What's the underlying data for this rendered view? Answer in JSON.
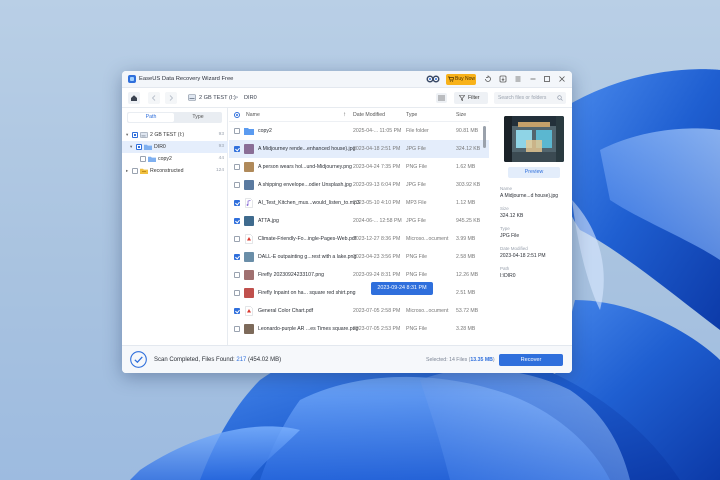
{
  "window": {
    "title": "EaseUS Data Recovery Wizard Free",
    "buy_label": "Buy Now"
  },
  "navbar": {
    "breadcrumb": [
      "2 GB TEST (I:)",
      "DIR0"
    ],
    "breadcrumb_sep": ">",
    "filter_label": "Filter",
    "search_placeholder": "Search files or folders"
  },
  "tree": {
    "tabs": [
      "Path",
      "Type"
    ],
    "active_tab": "Path",
    "items": [
      {
        "label": "2 GB TEST (I:)",
        "count": "93",
        "expanded": true,
        "checked": "partial"
      },
      {
        "label": "DIR0",
        "count": "93",
        "expanded": true,
        "checked": "partial",
        "selected": true
      },
      {
        "label": "copy2",
        "count": "44"
      },
      {
        "label": "Reconstructed",
        "count": "124",
        "expanded": false,
        "checked": false
      }
    ]
  },
  "list": {
    "columns": [
      "Name",
      "Date Modified",
      "Type",
      "Size"
    ],
    "sort_indicator": "↑",
    "rows": [
      {
        "name": "copy2",
        "date": "2025-04-... 11:05 PM",
        "type": "File folder",
        "size": "90.81 MB",
        "checked": false,
        "icon": "folder-icon"
      },
      {
        "name": "A Midjourney rende...enhanced house).jpg",
        "date": "2023-04-18 2:51 PM",
        "type": "JPG File",
        "size": "324.12 KB",
        "checked": true,
        "selected": true,
        "icon": "image-thumbnail"
      },
      {
        "name": "A person wears hol...und-Midjourney.png",
        "date": "2023-04-24 7:35 PM",
        "type": "PNG File",
        "size": "1.62 MB",
        "checked": false,
        "icon": "image-thumbnail"
      },
      {
        "name": "A shipping envelope...odier Unsplash.jpg",
        "date": "2023-09-13 6:04 PM",
        "type": "JPG File",
        "size": "303.92 KB",
        "checked": false,
        "icon": "image-thumbnail"
      },
      {
        "name": "AI_Test_Kitchen_mus...would_listen_to.mp3",
        "date": "2023-05-10 4:10 PM",
        "type": "MP3 File",
        "size": "1.12 MB",
        "checked": true,
        "icon": "audio-file-icon"
      },
      {
        "name": "ATTA.jpg",
        "date": "2024-06-... 12:58 PM",
        "type": "JPG File",
        "size": "945.25 KB",
        "checked": true,
        "icon": "image-thumbnail"
      },
      {
        "name": "Climate-Friendly-Fo...ingle-Pages-Web.pdf",
        "date": "2023-12-27 8:36 PM",
        "type": "Microso...ocument",
        "size": "3.99 MB",
        "checked": false,
        "icon": "pdf-file-icon"
      },
      {
        "name": "DALL-E outpainting g...rest with a lake.png",
        "date": "2023-04-23 3:56 PM",
        "type": "PNG File",
        "size": "2.58 MB",
        "checked": true,
        "icon": "image-thumbnail"
      },
      {
        "name": "Firefly 20230924233107.png",
        "date": "2023-09-24 8:31 PM",
        "type": "PNG File",
        "size": "12.26 MB",
        "checked": false,
        "icon": "image-thumbnail",
        "hovered": true
      },
      {
        "name": "Firefly Inpaint on ha... square red shirt.png",
        "date": "",
        "type": "",
        "size": "2.51 MB",
        "checked": false,
        "icon": "image-thumbnail"
      },
      {
        "name": "General Color Chart.pdf",
        "date": "2023-07-05 2:58 PM",
        "type": "Microso...ocument",
        "size": "53.72 MB",
        "checked": true,
        "icon": "pdf-file-icon"
      },
      {
        "name": "Leonardo-purple AR ...es Times square.png",
        "date": "2023-07-05 2:53 PM",
        "type": "PNG File",
        "size": "3.28 MB",
        "checked": false,
        "icon": "image-thumbnail"
      }
    ],
    "tooltip": "2023-09-24 8:31 PM"
  },
  "preview": {
    "button_label": "Preview",
    "fields": [
      {
        "label": "Name",
        "value": "A Midjourne...d house).jpg"
      },
      {
        "label": "Size",
        "value": "324.12 KB"
      },
      {
        "label": "Type",
        "value": "JPG File"
      },
      {
        "label": "Date Modified",
        "value": "2023-04-18 2:51 PM"
      },
      {
        "label": "Path",
        "value": "I:\\DIR0"
      }
    ]
  },
  "footer": {
    "scan_prefix": "Scan Completed, Files Found: ",
    "files_found": "217",
    "total_size": " (454.02 MB)",
    "selected_prefix": "Selected: 14 Files (",
    "selected_size": "13.35 MB",
    "selected_suffix": ")",
    "recover_label": "Recover"
  },
  "colors": {
    "accent": "#2f6fdc",
    "buy_button": "#f8b21a",
    "selected_row": "#e4edfb",
    "wallpaper_blue": "#1f5fd1"
  }
}
